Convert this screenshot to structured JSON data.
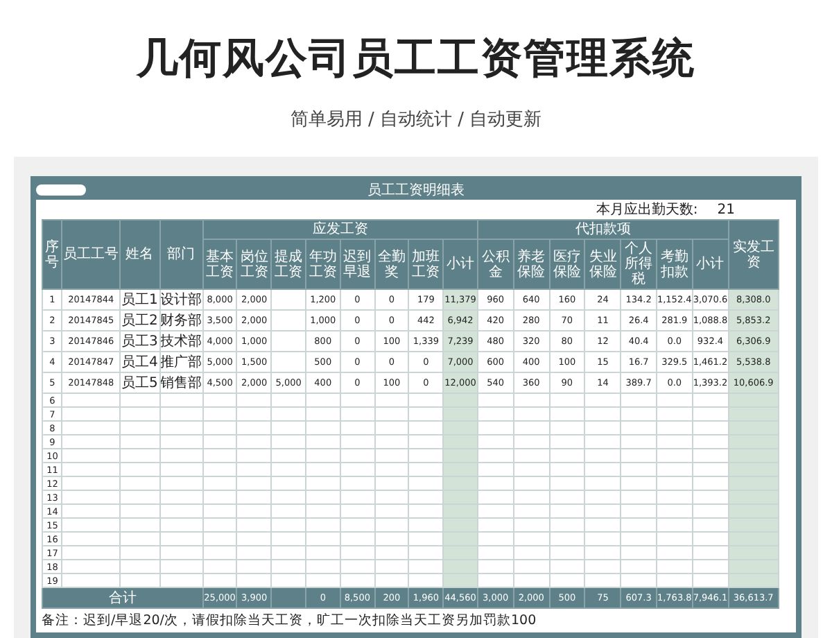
{
  "title": "几何风公司员工工资管理系统",
  "subtitle": "简单易用 / 自动统计 / 自动更新",
  "sheet": {
    "title": "员工工资明细表",
    "attendance_label": "本月应出勤天数:",
    "attendance_value": "21",
    "lead_columns": [
      {
        "label": "序号",
        "kind": "number"
      },
      {
        "label": "员工工号",
        "kind": "number"
      },
      {
        "label": "姓名",
        "kind": "text"
      },
      {
        "label": "部门",
        "kind": "text"
      }
    ],
    "groups": [
      {
        "label": "应发工资",
        "columns": [
          {
            "label": "基本工资",
            "kind": "number"
          },
          {
            "label": "岗位工资",
            "kind": "number"
          },
          {
            "label": "提成工资",
            "kind": "number"
          },
          {
            "label": "年功工资",
            "kind": "number"
          },
          {
            "label": "迟到早退",
            "kind": "number"
          },
          {
            "label": "全勤奖",
            "kind": "number"
          },
          {
            "label": "加班工资",
            "kind": "number"
          },
          {
            "label": "小计",
            "kind": "highlight"
          }
        ]
      },
      {
        "label": "代扣款项",
        "columns": [
          {
            "label": "公积金",
            "kind": "number"
          },
          {
            "label": "养老保险",
            "kind": "number"
          },
          {
            "label": "医疗保险",
            "kind": "number"
          },
          {
            "label": "失业保险",
            "kind": "number"
          },
          {
            "label": "个人所得税",
            "kind": "number"
          },
          {
            "label": "考勤扣款",
            "kind": "number"
          },
          {
            "label": "小计",
            "kind": "number"
          }
        ]
      }
    ],
    "final_column": {
      "label": "实发工资",
      "kind": "highlight"
    },
    "rows": [
      {
        "no": "1",
        "id": "20147844",
        "name": "员工1",
        "dept": "设计部",
        "base": "8,000",
        "post": "2,000",
        "seniority": "1,200",
        "late": "0",
        "attendance": "0",
        "overtime": "179",
        "gross": "11,379",
        "fund": "960",
        "pension": "640",
        "medical": "160",
        "unemployment": "24",
        "tax": "134.2",
        "absence": "1,152.4",
        "deductions": "3,070.6",
        "net": "8,308.0"
      },
      {
        "no": "2",
        "id": "20147845",
        "name": "员工2",
        "dept": "财务部",
        "base": "3,500",
        "post": "2,000",
        "seniority": "1,000",
        "late": "0",
        "attendance": "0",
        "overtime": "442",
        "gross": "6,942",
        "fund": "420",
        "pension": "280",
        "medical": "70",
        "unemployment": "11",
        "tax": "26.4",
        "absence": "281.9",
        "deductions": "1,088.8",
        "net": "5,853.2"
      },
      {
        "no": "3",
        "id": "20147846",
        "name": "员工3",
        "dept": "技术部",
        "base": "4,000",
        "post": "1,000",
        "seniority": "800",
        "late": "0",
        "attendance": "100",
        "overtime": "1,339",
        "gross": "7,239",
        "fund": "480",
        "pension": "320",
        "medical": "80",
        "unemployment": "12",
        "tax": "40.4",
        "absence": "0.0",
        "deductions": "932.4",
        "net": "6,306.9"
      },
      {
        "no": "4",
        "id": "20147847",
        "name": "员工4",
        "dept": "推广部",
        "base": "5,000",
        "post": "1,500",
        "seniority": "500",
        "late": "0",
        "attendance": "0",
        "overtime": "0",
        "gross": "7,000",
        "fund": "600",
        "pension": "400",
        "medical": "100",
        "unemployment": "15",
        "tax": "16.7",
        "absence": "329.5",
        "deductions": "1,461.2",
        "net": "5,538.8"
      },
      {
        "no": "5",
        "id": "20147848",
        "name": "员工5",
        "dept": "销售部",
        "base": "4,500",
        "post": "2,000",
        "commission": "5,000",
        "seniority": "400",
        "late": "0",
        "attendance": "100",
        "overtime": "0",
        "gross": "12,000",
        "fund": "540",
        "pension": "360",
        "medical": "90",
        "unemployment": "14",
        "tax": "389.7",
        "absence": "0.0",
        "deductions": "1,393.2",
        "net": "10,606.9"
      },
      {
        "no": "6"
      },
      {
        "no": "7"
      },
      {
        "no": "8"
      },
      {
        "no": "9"
      },
      {
        "no": "10"
      },
      {
        "no": "11"
      },
      {
        "no": "12"
      },
      {
        "no": "13"
      },
      {
        "no": "14"
      },
      {
        "no": "15"
      },
      {
        "no": "16"
      },
      {
        "no": "17"
      },
      {
        "no": "18"
      },
      {
        "no": "19"
      }
    ],
    "total": {
      "label": "合计",
      "values": {
        "base": "25,000",
        "post": "3,900",
        "seniority": "0",
        "late": "8,500",
        "attendance": "200",
        "overtime": "1,960",
        "gross": "44,560",
        "fund": "3,000",
        "pension": "2,000",
        "medical": "500",
        "unemployment": "75",
        "tax": "607.3",
        "absence": "1,763.8",
        "deductions": "7,946.1",
        "net": "36,613.7"
      }
    },
    "note": "备注：迟到/早退20/次，请假扣除当天工资，旷工一次扣除当天工资另加罚款100"
  }
}
